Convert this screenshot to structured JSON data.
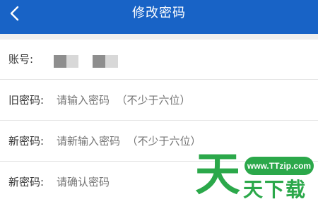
{
  "header": {
    "title": "修改密码",
    "back_icon": "chevron-left-icon",
    "color": "#1863c6"
  },
  "form": {
    "account": {
      "label": "账号:"
    },
    "old_password": {
      "label": "旧密码:",
      "placeholder": "请输入密码  （不少于六位）"
    },
    "new_password": {
      "label": "新密码:",
      "placeholder": "请新输入密码  （不少于六位）"
    },
    "confirm_password": {
      "label": "新密码:",
      "placeholder": "请确认密码"
    }
  },
  "watermark": {
    "url": "www.TTzip.com",
    "big_char": "天",
    "text": "天下载"
  }
}
